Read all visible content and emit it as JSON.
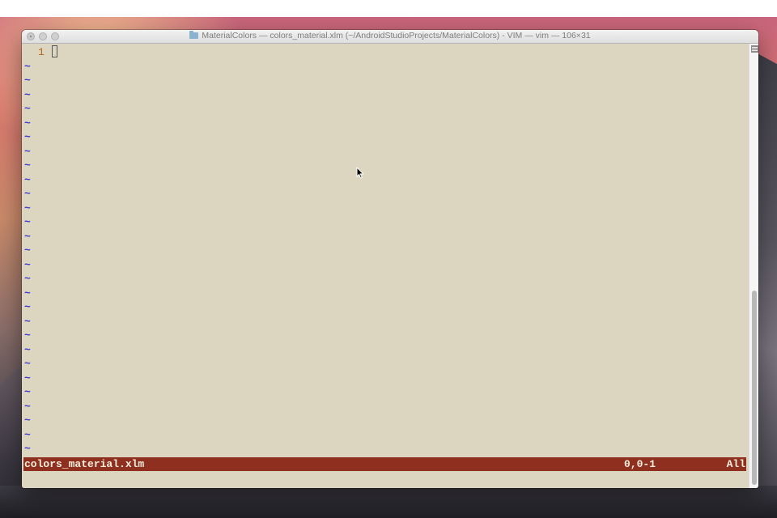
{
  "window": {
    "title": "MaterialColors — colors_material.xlm (~/AndroidStudioProjects/MaterialColors) - VIM — vim — 106×31",
    "title_icon": "folder-icon"
  },
  "editor": {
    "line_number": "1",
    "empty_line_marker": "~",
    "empty_line_count": 28,
    "colors": {
      "background": "#dcd6c0",
      "line_number": "#b3641a",
      "tilde": "#3b3bd6",
      "status_bar": "#8e2f20",
      "status_text": "#f6efdc"
    }
  },
  "status_bar": {
    "file_name": "colors_material.xlm",
    "position": "0,0-1",
    "scroll": "All"
  }
}
